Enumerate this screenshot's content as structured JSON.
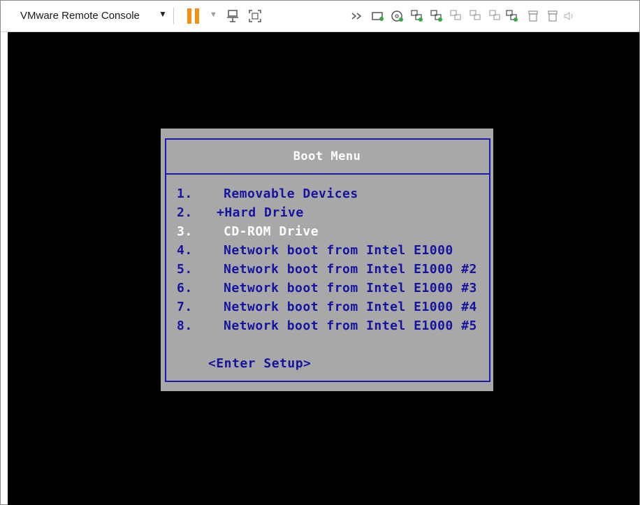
{
  "toolbar": {
    "app_title": "VMware Remote Console",
    "icons": [
      "dropdown-caret-icon",
      "pause-icon",
      "dropdown-caret-icon",
      "send-ctrl-alt-del-icon",
      "fullscreen-icon",
      "more-icon",
      "hard-disk-icon",
      "cd-rom-icon",
      "network-adapter-icon",
      "network-adapter-icon",
      "network-adapter-icon",
      "network-adapter-icon",
      "network-adapter-icon",
      "usb-icon",
      "usb-icon",
      "sound-icon"
    ]
  },
  "bios": {
    "title": "Boot Menu",
    "items": [
      {
        "num": "1.",
        "label": "Removable Devices"
      },
      {
        "num": "2.",
        "label": "+Hard Drive"
      },
      {
        "num": "3.",
        "label": "CD-ROM Drive"
      },
      {
        "num": "4.",
        "label": "Network boot from Intel E1000"
      },
      {
        "num": "5.",
        "label": "Network boot from Intel E1000 #2"
      },
      {
        "num": "6.",
        "label": "Network boot from Intel E1000 #3"
      },
      {
        "num": "7.",
        "label": "Network boot from Intel E1000 #4"
      },
      {
        "num": "8.",
        "label": "Network boot from Intel E1000 #5"
      }
    ],
    "selected_index": 2,
    "enter_setup": "<Enter Setup>"
  },
  "colors": {
    "pause_accent": "#f29012",
    "bios_background": "#a8a8a8",
    "bios_text": "#1414a0",
    "bios_highlight_text": "#ffffff",
    "console_background": "#000000"
  }
}
